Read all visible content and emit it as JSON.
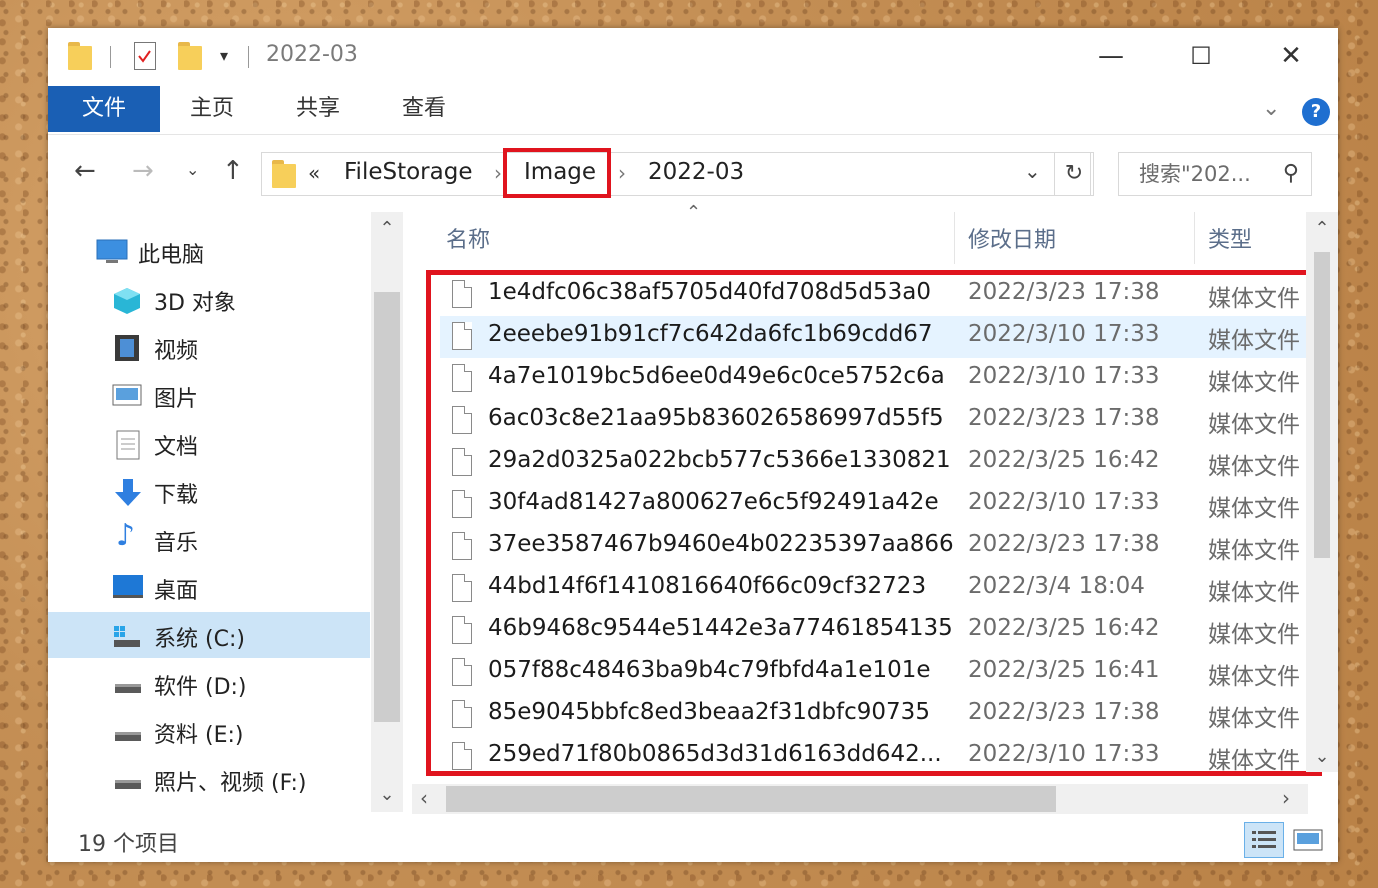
{
  "window": {
    "title": "2022-03",
    "controls": {
      "minimize": "—",
      "maximize": "☐",
      "close": "✕"
    }
  },
  "ribbon": {
    "tabs": [
      {
        "label": "文件"
      },
      {
        "label": "主页"
      },
      {
        "label": "共享"
      },
      {
        "label": "查看"
      }
    ],
    "help": "?"
  },
  "address": {
    "overflow": "«",
    "crumbs": [
      "FileStorage",
      "Image",
      "2022-03"
    ],
    "separator": "›"
  },
  "search": {
    "placeholder": "搜索\"202..."
  },
  "sidebar": {
    "items": [
      {
        "label": "此电脑",
        "icon": "computer-icon"
      },
      {
        "label": "3D 对象",
        "icon": "cube-icon"
      },
      {
        "label": "视频",
        "icon": "video-icon"
      },
      {
        "label": "图片",
        "icon": "picture-icon"
      },
      {
        "label": "文档",
        "icon": "document-icon"
      },
      {
        "label": "下载",
        "icon": "download-icon"
      },
      {
        "label": "音乐",
        "icon": "music-icon"
      },
      {
        "label": "桌面",
        "icon": "desktop-icon"
      },
      {
        "label": "系统 (C:)",
        "icon": "drive-icon",
        "selected": true
      },
      {
        "label": "软件 (D:)",
        "icon": "drive-icon"
      },
      {
        "label": "资料 (E:)",
        "icon": "drive-icon"
      },
      {
        "label": "照片、视频 (F:)",
        "icon": "drive-icon"
      }
    ]
  },
  "columns": {
    "name": "名称",
    "modified": "修改日期",
    "type": "类型"
  },
  "files": [
    {
      "name": "1e4dfc06c38af5705d40fd708d5d53a0",
      "modified": "2022/3/23 17:38",
      "type": "媒体文件"
    },
    {
      "name": "2eeebe91b91cf7c642da6fc1b69cdd67",
      "modified": "2022/3/10 17:33",
      "type": "媒体文件"
    },
    {
      "name": "4a7e1019bc5d6ee0d49e6c0ce5752c6a",
      "modified": "2022/3/10 17:33",
      "type": "媒体文件"
    },
    {
      "name": "6ac03c8e21aa95b836026586997d55f5",
      "modified": "2022/3/23 17:38",
      "type": "媒体文件"
    },
    {
      "name": "29a2d0325a022bcb577c5366e1330821",
      "modified": "2022/3/25 16:42",
      "type": "媒体文件"
    },
    {
      "name": "30f4ad81427a800627e6c5f92491a42e",
      "modified": "2022/3/10 17:33",
      "type": "媒体文件"
    },
    {
      "name": "37ee3587467b9460e4b02235397aa866",
      "modified": "2022/3/23 17:38",
      "type": "媒体文件"
    },
    {
      "name": "44bd14f6f1410816640f66c09cf32723",
      "modified": "2022/3/4 18:04",
      "type": "媒体文件"
    },
    {
      "name": "46b9468c9544e51442e3a77461854135",
      "modified": "2022/3/25 16:42",
      "type": "媒体文件"
    },
    {
      "name": "057f88c48463ba9b4c79fbfd4a1e101e",
      "modified": "2022/3/25 16:41",
      "type": "媒体文件"
    },
    {
      "name": "85e9045bbfc8ed3beaa2f31dbfc90735",
      "modified": "2022/3/23 17:38",
      "type": "媒体文件"
    },
    {
      "name": "259ed71f80b0865d3d31d6163dd642...",
      "modified": "2022/3/10 17:33",
      "type": "媒体文件"
    }
  ],
  "status": {
    "count": "19 个项目"
  },
  "colors": {
    "accent": "#1a5fb4",
    "highlight": "#e0141e",
    "selected": "#cce4f7"
  }
}
